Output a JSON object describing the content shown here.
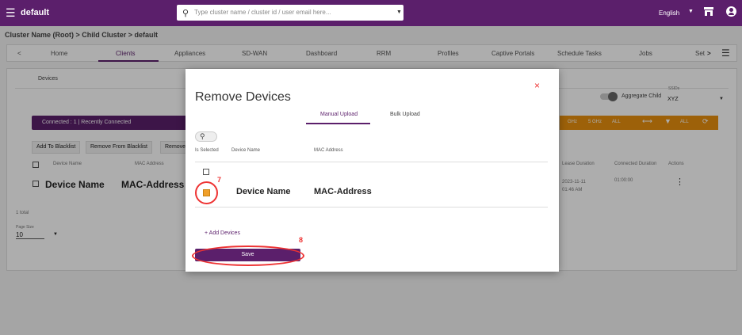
{
  "topbar": {
    "menu_icon": "☰",
    "title": "default",
    "search_placeholder": "Type cluster name / cluster id / user email here...",
    "search_icon": "search-icon",
    "lang": "English",
    "brand_color": "#5b1f6b"
  },
  "breadcrumb": "Cluster Name (Root) > Child Cluster > default",
  "nav": {
    "prev": "<",
    "next": ">",
    "menu": "☰",
    "tabs": [
      "Home",
      "Clients",
      "Appliances",
      "SD-WAN",
      "Dashboard",
      "RRM",
      "Profiles",
      "Captive Portals",
      "Schedule Tasks",
      "Jobs",
      "Set"
    ]
  },
  "panel": {
    "tab": "Devices",
    "aggregate": "Aggregate Child",
    "ssids_label": "SSIDs",
    "ssid_value": "XYZ",
    "connected_text": "Connected : 1 | Recently Connected",
    "band_a": "GHz",
    "band_b": "5 GHz",
    "all_a": "ALL",
    "all_b": "ALL",
    "refresh": "⟳",
    "buttons": {
      "blacklist_add": "Add To Blacklist",
      "blacklist_remove": "Remove From Blacklist",
      "remove_short": "Remove F"
    },
    "cols": {
      "device": "Device Name",
      "mac": "MAC Address",
      "lease": "Lease Duration",
      "connected": "Connected Duration",
      "actions": "Actions"
    },
    "row": {
      "device": "Device Name",
      "mac": "MAC-Address",
      "lease": "2023-11-11 01:46 AM",
      "connected": "01:00:00",
      "actions": "⋮"
    },
    "total": "1 total",
    "page_size_label": "Page Size",
    "page_size": "10"
  },
  "modal": {
    "title": "Remove Devices",
    "close": "×",
    "tabs": [
      "Manual Upload",
      "Bulk Upload"
    ],
    "cols": {
      "selected": "Is Selected",
      "device": "Device Name",
      "mac": "MAC Address"
    },
    "row": {
      "device": "Device Name",
      "mac": "MAC-Address"
    },
    "add_devices": "+ Add Devices",
    "save": "Save",
    "step7": "7",
    "step8": "8"
  }
}
